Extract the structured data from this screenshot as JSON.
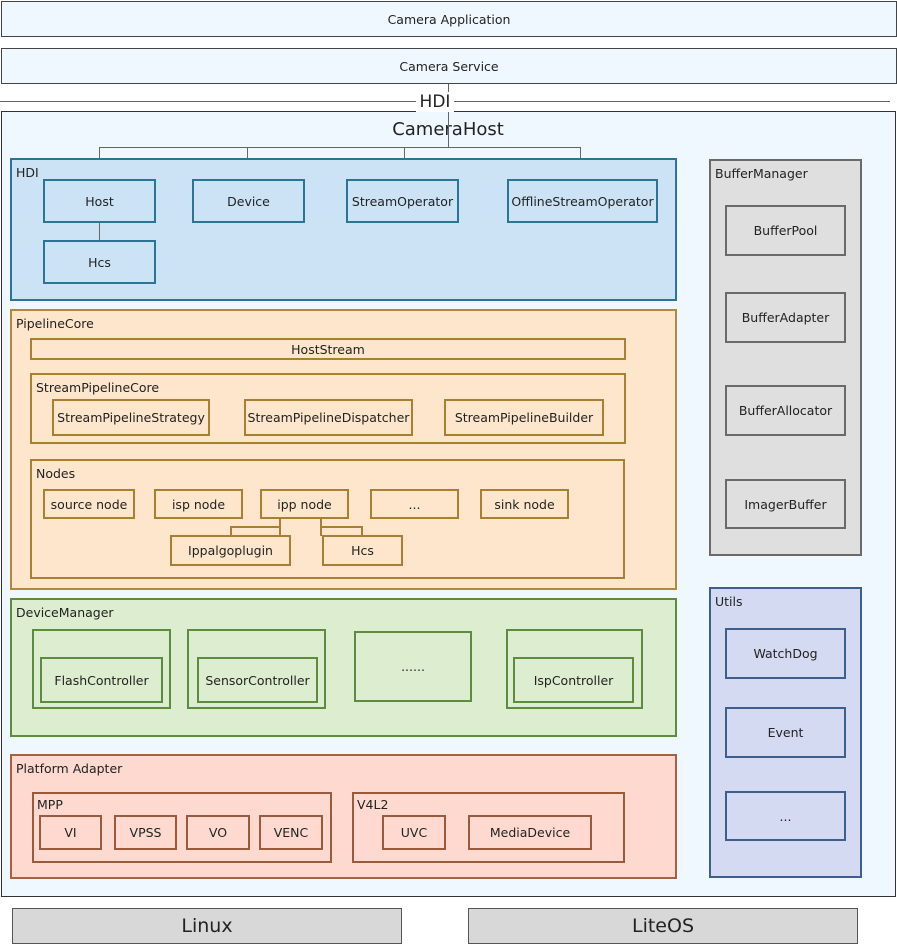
{
  "layers": {
    "application": "Camera Application",
    "service": "Camera Service",
    "hdi_label": "HDI"
  },
  "camera_host": {
    "title": "CameraHost",
    "hdi": {
      "label": "HDI",
      "host": "Host",
      "device": "Device",
      "stream_operator": "StreamOperator",
      "offline_stream_operator": "OfflineStreamOperator",
      "hcs": "Hcs"
    },
    "pipeline_core": {
      "label": "PipelineCore",
      "host_stream": "HostStream",
      "stream_pipeline_core": {
        "label": "StreamPipelineCore",
        "items": [
          "StreamPipelineStrategy",
          "StreamPipelineDispatcher",
          "StreamPipelineBuilder"
        ]
      },
      "nodes": {
        "label": "Nodes",
        "items": [
          "source node",
          "isp node",
          "ipp node",
          "...",
          "sink node"
        ],
        "ipp_children": [
          "Ippalgoplugin",
          "Hcs"
        ]
      }
    },
    "device_manager": {
      "label": "DeviceManager",
      "items": [
        "FlashController",
        "SensorController",
        "......",
        "IspController"
      ]
    },
    "platform_adapter": {
      "label": "Platform Adapter",
      "mpp": {
        "label": "MPP",
        "items": [
          "VI",
          "VPSS",
          "VO",
          "VENC"
        ]
      },
      "v4l2": {
        "label": "V4L2",
        "items": [
          "UVC",
          "MediaDevice"
        ]
      }
    },
    "buffer_manager": {
      "label": "BufferManager",
      "items": [
        "BufferPool",
        "BufferAdapter",
        "BufferAllocator",
        "ImagerBuffer"
      ]
    },
    "utils": {
      "label": "Utils",
      "items": [
        "WatchDog",
        "Event",
        "..."
      ]
    }
  },
  "os": {
    "linux": "Linux",
    "liteos": "LiteOS"
  }
}
